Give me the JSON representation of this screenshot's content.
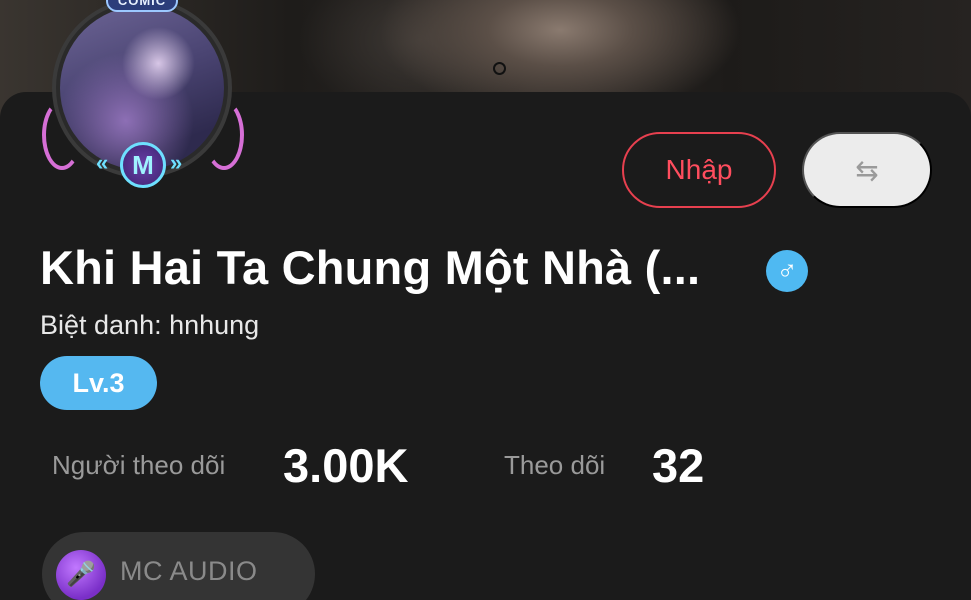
{
  "avatar": {
    "frame_tag": "COMIC",
    "badge_letter": "M",
    "badge_left_arrows": "«",
    "badge_right_arrows": "»"
  },
  "actions": {
    "import_label": "Nhập",
    "switch_glyph": "⇆"
  },
  "profile": {
    "title": "Khi Hai Ta Chung Một Nhà (...",
    "gender_glyph": "♂",
    "nickname": "Biệt danh: hnhung",
    "level": "Lv.3"
  },
  "stats": {
    "followers_label": "Người theo dõi",
    "followers_value": "3.00K",
    "following_label": "Theo dõi",
    "following_value": "32"
  },
  "tag": {
    "label": "MC AUDIO",
    "icon_glyph": "🎤"
  },
  "colors": {
    "accent_red": "#e7404f",
    "level_blue": "#55b8f0",
    "background": "#1b1b1b"
  },
  "icons": [
    "gender-male-icon",
    "switch-arrows-icon",
    "microphone-icon",
    "avatar-frame-icon"
  ]
}
